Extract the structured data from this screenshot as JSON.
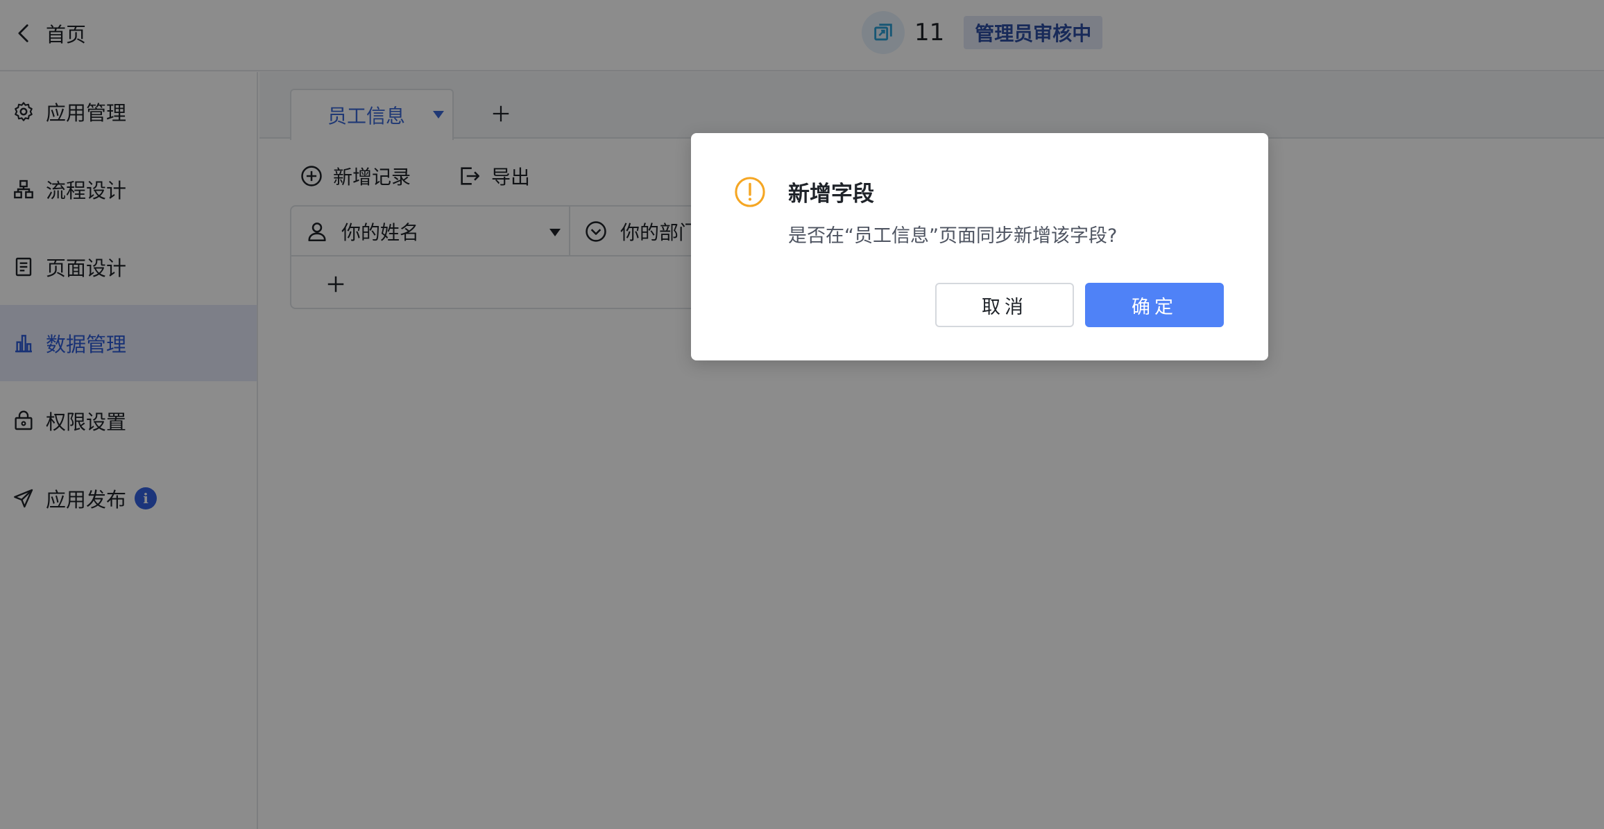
{
  "header": {
    "back_label": "首页",
    "app_name": "11",
    "status_badge": "管理员审核中",
    "app_logo_icon": "app-logo-icon"
  },
  "sidebar": {
    "items": [
      {
        "label": "应用管理",
        "icon": "gear-icon"
      },
      {
        "label": "流程设计",
        "icon": "flow-icon"
      },
      {
        "label": "页面设计",
        "icon": "page-icon"
      },
      {
        "label": "数据管理",
        "icon": "bar-chart-icon",
        "active": true
      },
      {
        "label": "权限设置",
        "icon": "lock-icon"
      },
      {
        "label": "应用发布",
        "icon": "send-icon",
        "badge": "i"
      }
    ],
    "active_color": "#2d5ad6"
  },
  "main": {
    "tabs": [
      {
        "label": "员工信息",
        "active": true
      }
    ],
    "toolbar": {
      "add_record": "新增记录",
      "export": "导出"
    },
    "grid": {
      "columns": [
        {
          "label": "你的姓名",
          "icon": "user-icon"
        },
        {
          "label": "你的部门",
          "icon": "select-circle-icon"
        }
      ]
    }
  },
  "dialog": {
    "title": "新增字段",
    "message": "是否在“员工信息”页面同步新增该字段?",
    "cancel_label": "取消",
    "confirm_label": "确定",
    "icon": "warning-icon",
    "accent_color": "#4f82f7",
    "warning_color": "#f5a623"
  }
}
